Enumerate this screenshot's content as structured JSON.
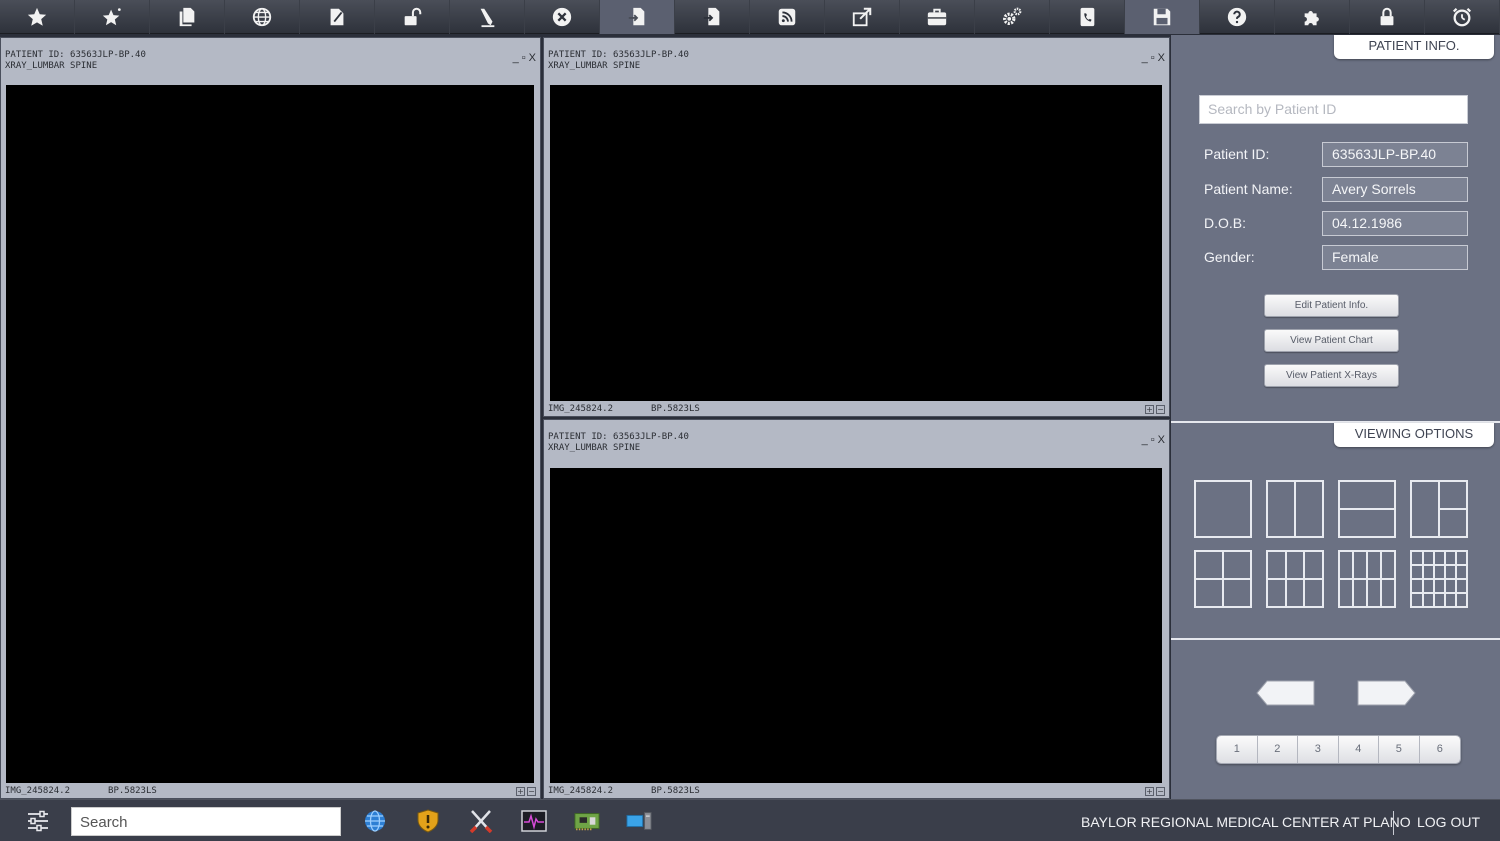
{
  "toolbar": {
    "icons": [
      "star-icon",
      "star-sparkle-icon",
      "documents-icon",
      "globe-icon",
      "edit-document-icon",
      "unlock-icon",
      "pencil-icon",
      "close-circle-icon",
      "import-document-icon",
      "export-document-icon",
      "rss-icon",
      "share-icon",
      "briefcase-icon",
      "gears-icon",
      "phonebook-icon",
      "save-icon",
      "help-icon",
      "puzzle-icon",
      "lock-icon",
      "clock-icon"
    ],
    "active": [
      "import-document-icon",
      "save-icon"
    ]
  },
  "viewers": [
    {
      "patient_line": "PATIENT ID: 63563JLP-BP.40",
      "study_line": "XRAY_LUMBAR SPINE",
      "image_id": "IMG_245824.2",
      "body_part": "BP.5823LS"
    },
    {
      "patient_line": "PATIENT ID: 63563JLP-BP.40",
      "study_line": "XRAY_LUMBAR SPINE",
      "image_id": "IMG_245824.2",
      "body_part": "BP.5823LS"
    },
    {
      "patient_line": "PATIENT ID: 63563JLP-BP.40",
      "study_line": "XRAY_LUMBAR SPINE",
      "image_id": "IMG_245824.2",
      "body_part": "BP.5823LS"
    }
  ],
  "window_controls": {
    "minimize": "_",
    "maximize": "▫",
    "close": "X",
    "zoom_in": "+",
    "zoom_out": "−"
  },
  "patient_info": {
    "title": "PATIENT INFO.",
    "search_placeholder": "Search by Patient ID",
    "fields": [
      {
        "label": "Patient ID:",
        "value": "63563JLP-BP.40"
      },
      {
        "label": "Patient Name:",
        "value": "Avery Sorrels"
      },
      {
        "label": "D.O.B:",
        "value": "04.12.1986"
      },
      {
        "label": "Gender:",
        "value": "Female"
      }
    ],
    "buttons": [
      "Edit Patient Info.",
      "View Patient Chart",
      "View Patient X-Rays"
    ]
  },
  "viewing_options": {
    "title": "VIEWING OPTIONS",
    "layouts": [
      "layout-1x1-icon",
      "layout-2-columns-icon",
      "layout-2-rows-icon",
      "layout-1-plus-2-icon",
      "layout-2x2-icon",
      "layout-3x2-icon",
      "layout-4x2-icon",
      "layout-5x4-icon"
    ]
  },
  "pager": {
    "pages": [
      "1",
      "2",
      "3",
      "4",
      "5",
      "6"
    ]
  },
  "taskbar": {
    "search_placeholder": "Search",
    "apps": [
      "globe-icon",
      "shield-icon",
      "tools-icon",
      "heart-monitor-icon",
      "circuit-board-icon",
      "computer-icon"
    ],
    "organization": "BAYLOR REGIONAL MEDICAL CENTER AT PLANO",
    "logout": "LOG OUT"
  },
  "colors": {
    "panel": "#6b7183",
    "pane": "#b4b9c5",
    "toolbar": "#3a3e48",
    "taskbar": "#3a3e4a"
  }
}
